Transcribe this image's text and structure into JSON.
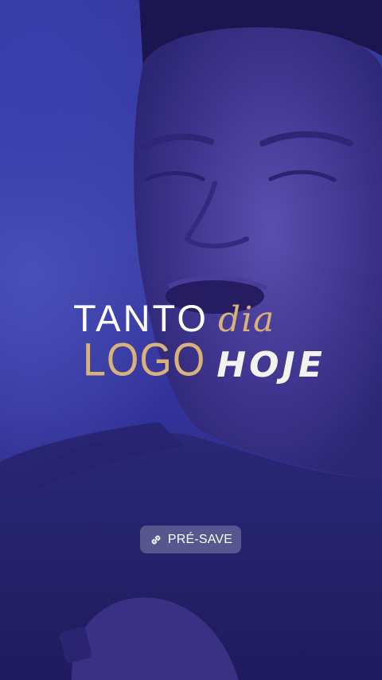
{
  "story": {
    "title_line1_word1": "TANTO",
    "title_line1_word2": "dia",
    "title_line2_word1": "LOGO",
    "title_line2_word2": "HOJE",
    "link_sticker": {
      "label": "PRÉ-SAVE",
      "icon": "link-icon"
    }
  },
  "colors": {
    "background": "#34389c",
    "gold_accent": "#d9b27a",
    "white_text": "#ffffff",
    "sticker_bg": "#7876a5"
  }
}
